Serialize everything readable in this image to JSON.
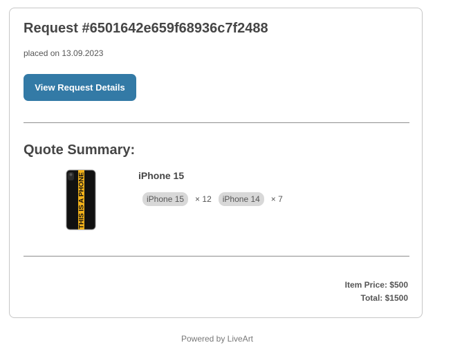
{
  "request": {
    "title": "Request #6501642e659f68936c7f2488",
    "placed": "placed on 13.09.2023",
    "view_button_label": "View Request Details"
  },
  "summary": {
    "title": "Quote Summary:",
    "product": {
      "name": "iPhone 15",
      "image_text": "THIS IS A PHONE",
      "variants": [
        {
          "label": "iPhone 15",
          "qty": "× 12"
        },
        {
          "label": "iPhone 14",
          "qty": "× 7"
        }
      ]
    },
    "item_price": "Item Price: $500",
    "total": "Total: $1500"
  },
  "footer": {
    "text": "Powered by LiveArt"
  },
  "colors": {
    "button": "#337aa6",
    "case_black": "#111111",
    "case_yellow": "#f2b21b",
    "chip_bg": "#d8d8d8"
  }
}
